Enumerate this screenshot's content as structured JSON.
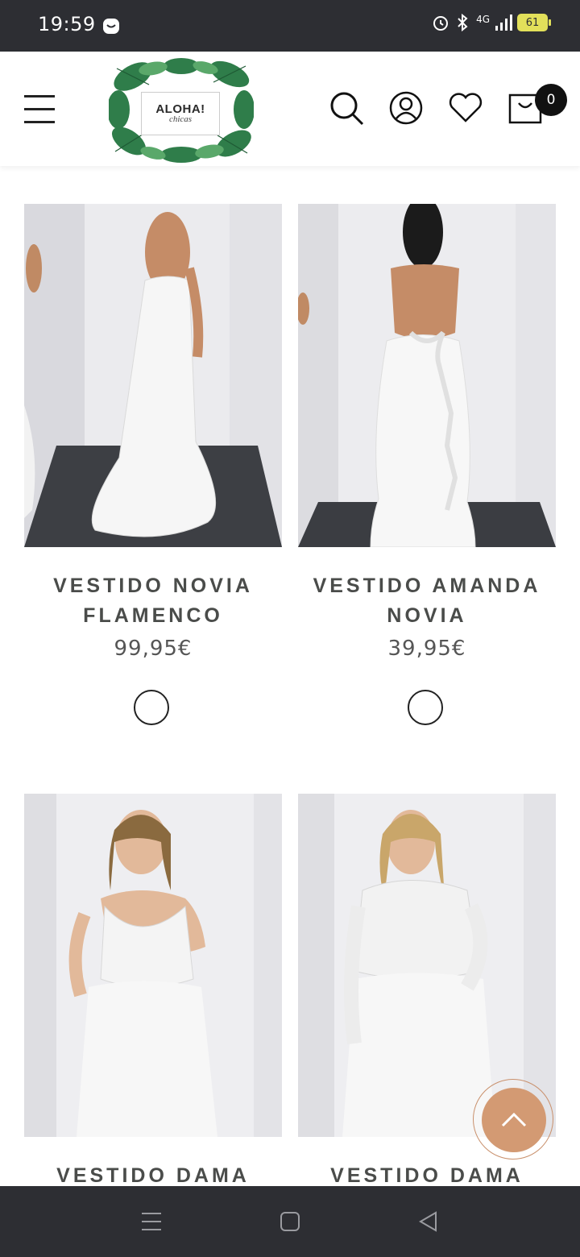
{
  "status_bar": {
    "time": "19:59",
    "network": "4G",
    "battery": "61"
  },
  "header": {
    "logo_title": "ALOHA!",
    "logo_subtitle": "chicas",
    "cart_count": "0"
  },
  "products": [
    {
      "title": "VESTIDO NOVIA FLAMENCO",
      "price": "99,95€"
    },
    {
      "title": "VESTIDO AMANDA NOVIA",
      "price": "39,95€"
    },
    {
      "title": "VESTIDO DAMA",
      "price": ""
    },
    {
      "title": "VESTIDO DAMA",
      "price": ""
    }
  ],
  "colors": {
    "accent": "#d39a73",
    "status_bar": "#2d2e33",
    "title_text": "#4a4c4a"
  }
}
